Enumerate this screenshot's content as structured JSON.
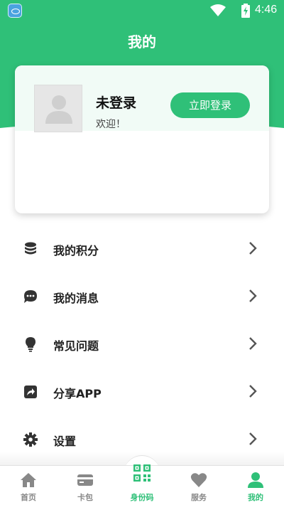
{
  "status_bar": {
    "time": "4:46",
    "app_icon": "app-notification-icon",
    "wifi_icon": "wifi-icon",
    "battery_icon": "battery-charging-icon"
  },
  "header": {
    "title": "我的"
  },
  "profile": {
    "status": "未登录",
    "welcome": "欢迎！",
    "login_button": "立即登录",
    "avatar_icon": "default-avatar-icon"
  },
  "menu": [
    {
      "label": "我的积分",
      "icon": "database-icon"
    },
    {
      "label": "我的消息",
      "icon": "chat-icon"
    },
    {
      "label": "常见问题",
      "icon": "lightbulb-icon"
    },
    {
      "label": "分享APP",
      "icon": "share-icon"
    },
    {
      "label": "设置",
      "icon": "gear-icon"
    }
  ],
  "tabs": [
    {
      "label": "首页",
      "icon": "home-icon"
    },
    {
      "label": "卡包",
      "icon": "card-icon"
    },
    {
      "label": "身份码",
      "icon": "qr-code-icon"
    },
    {
      "label": "服务",
      "icon": "heart-icon"
    },
    {
      "label": "我的",
      "icon": "person-icon"
    }
  ],
  "colors": {
    "accent": "#2fc078",
    "icon_gray": "#888888",
    "text_dark": "#222222"
  }
}
